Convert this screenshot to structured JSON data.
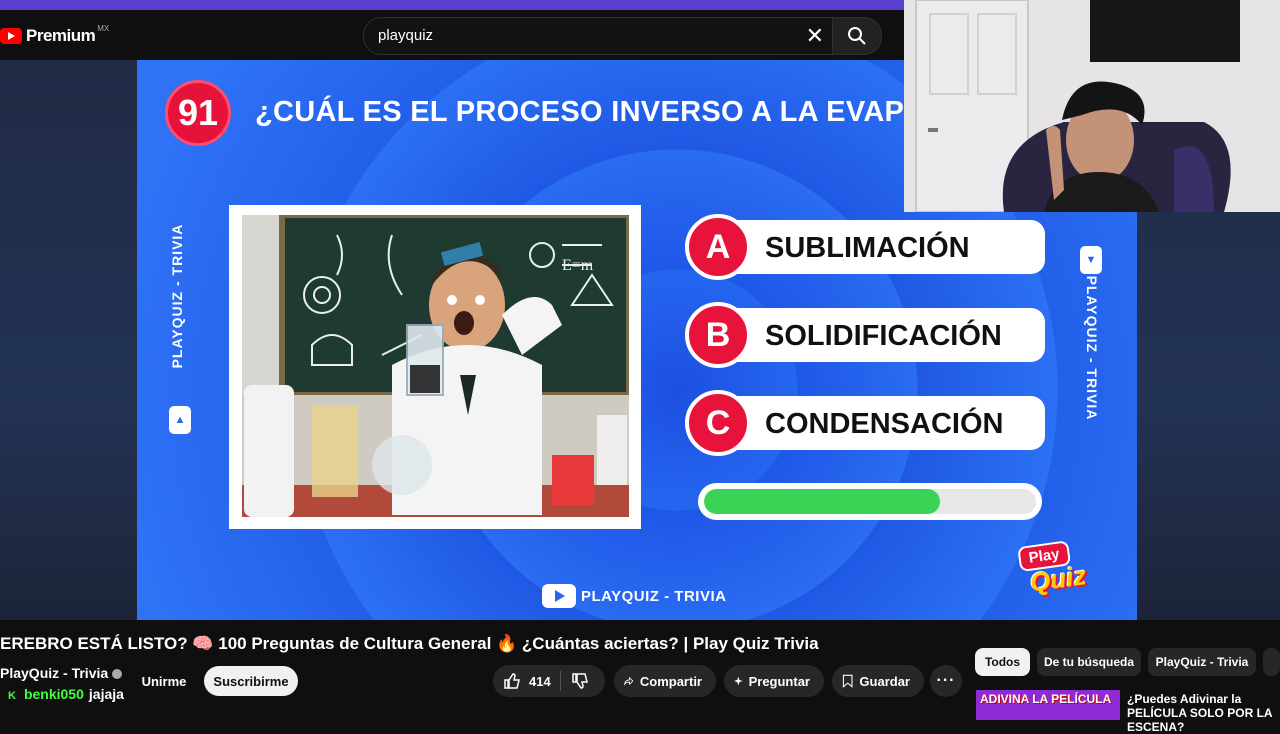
{
  "header": {
    "logo_text": "Premium",
    "logo_region": "MX",
    "search_value": "playquiz"
  },
  "video": {
    "question_number": "91",
    "question_text": "¿CUÁL ES EL PROCESO INVERSO A LA EVAPO",
    "side_label_left": "PLAYQUIZ - TRIVIA",
    "side_label_right": "PLAYQUIZ - TRIVIA",
    "answers": [
      {
        "letter": "A",
        "text": "SUBLIMACIÓN"
      },
      {
        "letter": "B",
        "text": "SOLIDIFICACIÓN"
      },
      {
        "letter": "C",
        "text": "CONDENSACIÓN"
      }
    ],
    "progress_fraction": 0.71,
    "progress_color": "#3ad356",
    "bottom_brand": "PLAYQUIZ - TRIVIA",
    "logo_play": "Play",
    "logo_quiz": "Quiz",
    "colors": {
      "background": "#2a68f0",
      "accent": "#e8133b"
    }
  },
  "info": {
    "title": "EREBRO ESTÁ LISTO? 🧠 100 Preguntas de Cultura General 🔥 ¿Cuántas aciertas? | Play Quiz Trivia",
    "channel_name": "PlayQuiz - Trivia",
    "join_label": "Unirme",
    "subscribe_label": "Suscribirme",
    "like_count": "414",
    "share_label": "Compartir",
    "ask_label": "Preguntar",
    "save_label": "Guardar"
  },
  "chips": [
    "Todos",
    "De tu búsqueda",
    "PlayQuiz - Trivia"
  ],
  "chat": {
    "badge": "K",
    "username": "benki050",
    "message": "jajaja"
  },
  "recommendation": {
    "thumb_text": "ADIVINA LA PELÍCULA",
    "title": "¿Puedes Adivinar la PELÍCULA SOLO POR LA ESCENA?"
  }
}
